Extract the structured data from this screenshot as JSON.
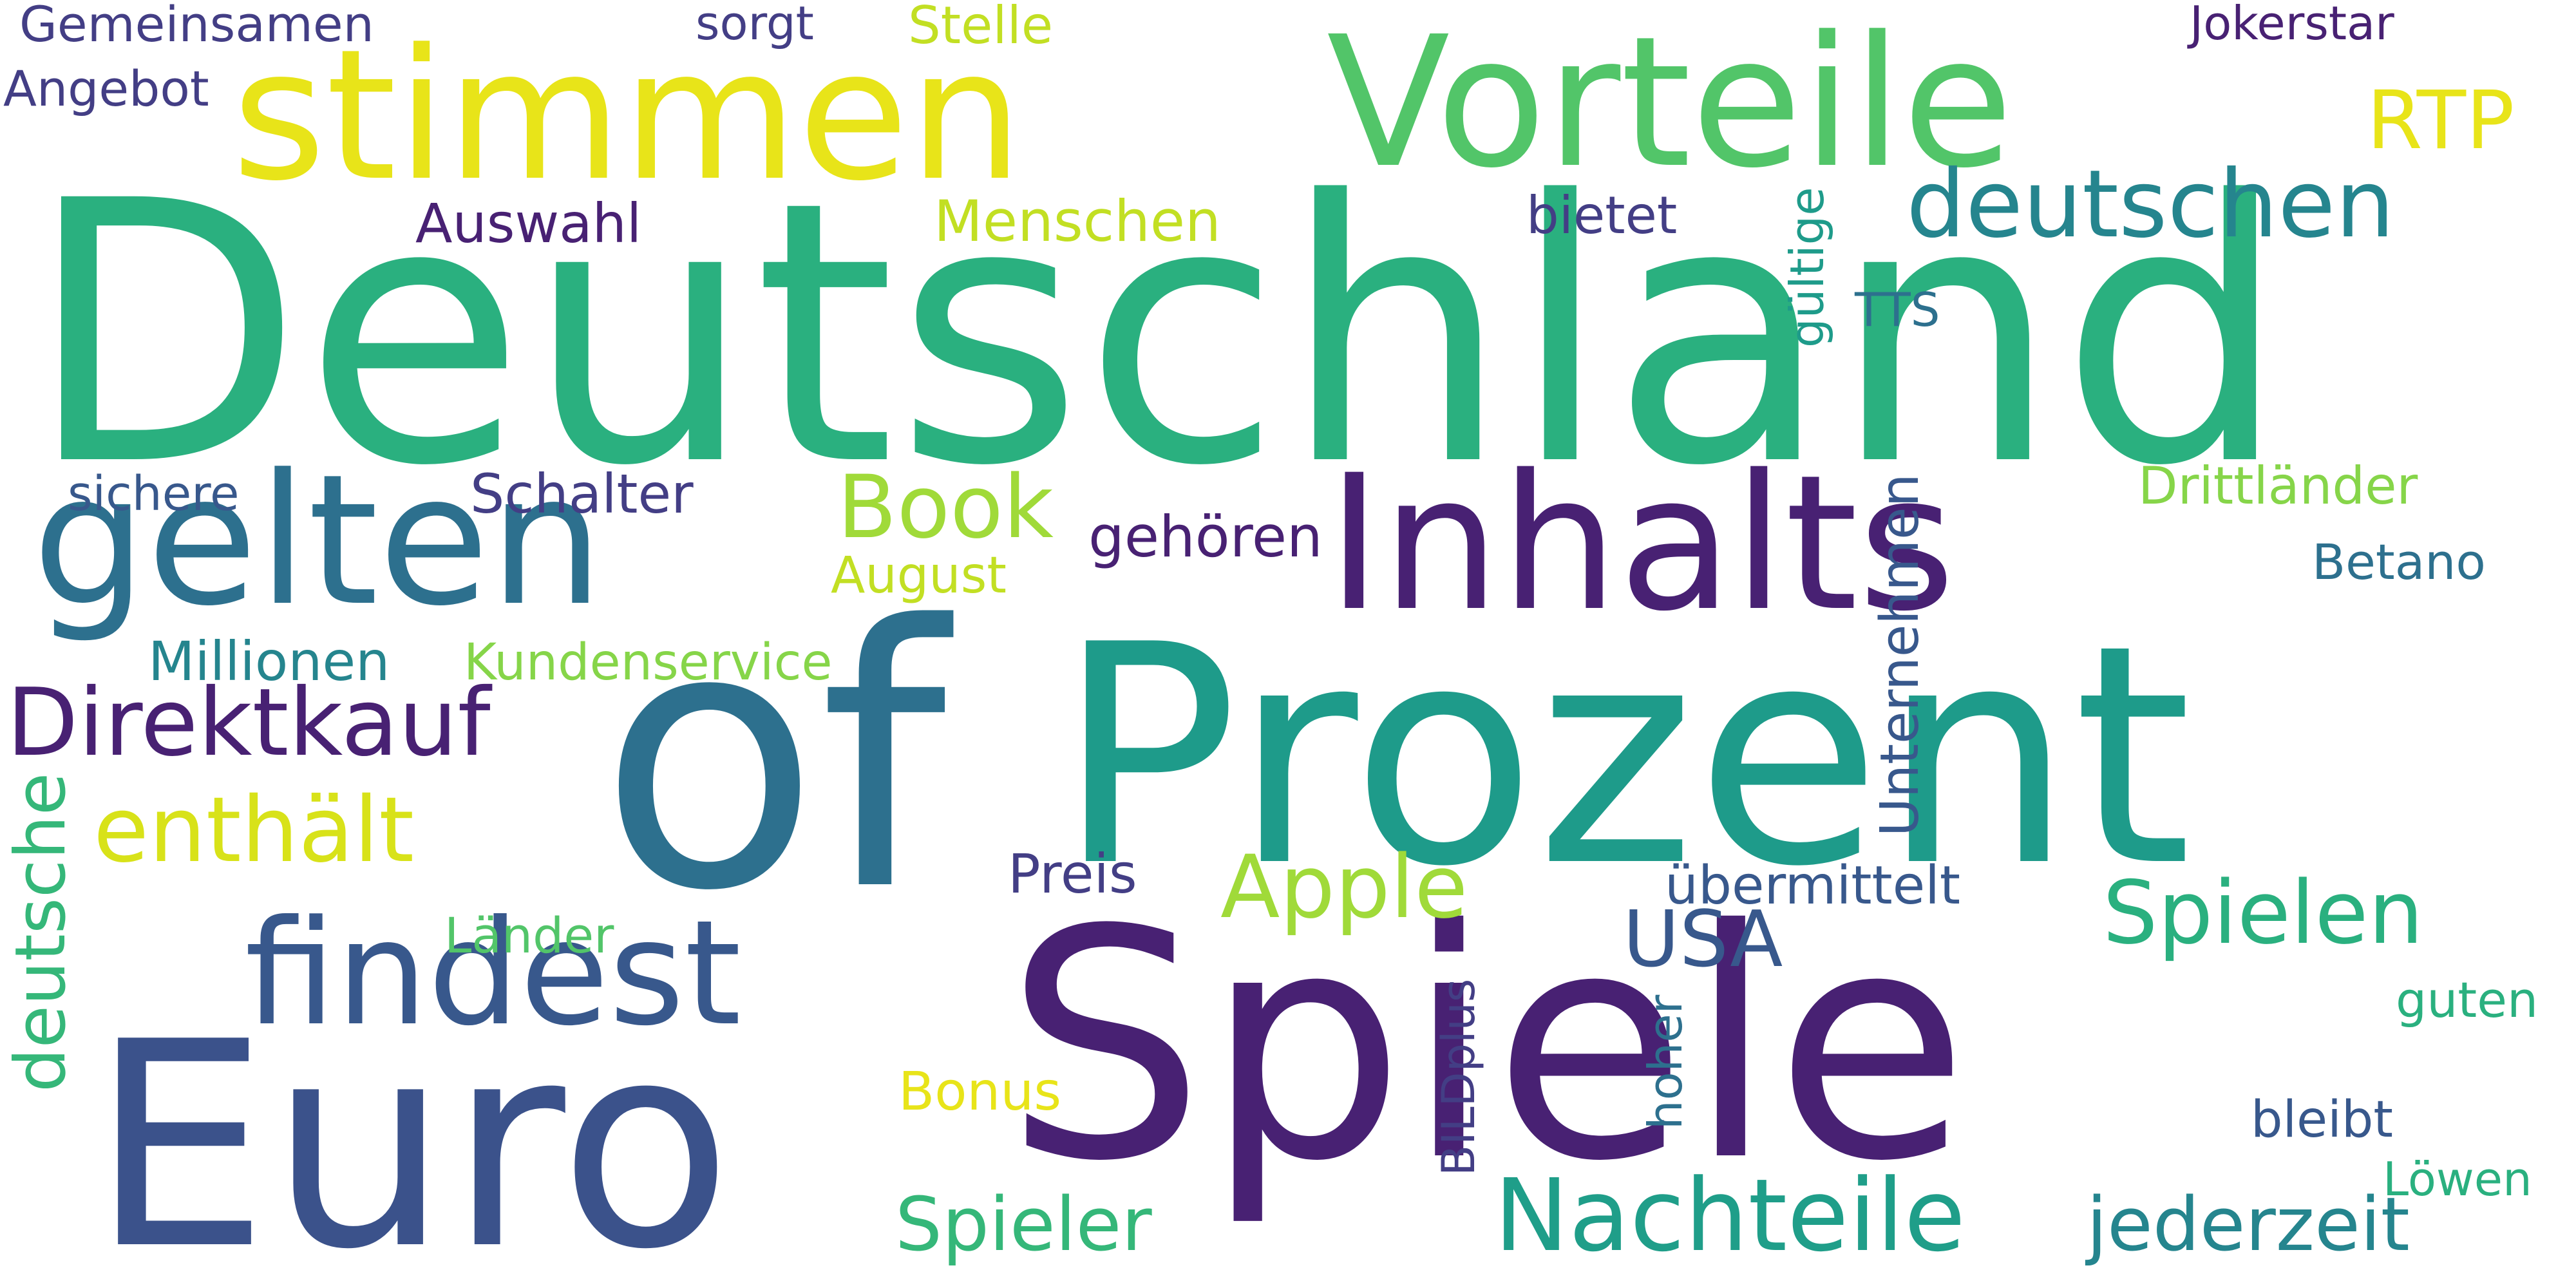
{
  "canvas": {
    "background": "#ffffff"
  },
  "palette": {
    "deep_purple": "#482173",
    "indigo": "#433e85",
    "blue": "#38588c",
    "steel_blue": "#2d708e",
    "teal": "#25858e",
    "green_teal": "#1e9b8a",
    "green": "#2ab07f",
    "light_green": "#52c569",
    "lime": "#86d549",
    "yellow_green": "#c2df23",
    "yellow": "#e8e419"
  },
  "words": [
    {
      "text": "Deutschland",
      "color": "#2ab07f",
      "rotation": 0
    },
    {
      "text": "Prozent",
      "color": "#1e9b8a",
      "rotation": 0
    },
    {
      "text": "Spiele",
      "color": "#482173",
      "rotation": 0
    },
    {
      "text": "of",
      "color": "#2d708e",
      "rotation": 0
    },
    {
      "text": "Euro",
      "color": "#3b528b",
      "rotation": 0
    },
    {
      "text": "stimmen",
      "color": "#e8e419",
      "rotation": 0
    },
    {
      "text": "Vorteile",
      "color": "#52c569",
      "rotation": 0
    },
    {
      "text": "Inhalts",
      "color": "#482173",
      "rotation": 0
    },
    {
      "text": "gelten",
      "color": "#2d708e",
      "rotation": 0
    },
    {
      "text": "findest",
      "color": "#38588c",
      "rotation": 0
    },
    {
      "text": "deutschen",
      "color": "#25858e",
      "rotation": 0
    },
    {
      "text": "Nachteile",
      "color": "#1f9e89",
      "rotation": 0
    },
    {
      "text": "Direktkauf",
      "color": "#482173",
      "rotation": 0
    },
    {
      "text": "enthält",
      "color": "#d8e219",
      "rotation": 0
    },
    {
      "text": "Book",
      "color": "#a0da39",
      "rotation": 0
    },
    {
      "text": "Apple",
      "color": "#a0da39",
      "rotation": 0
    },
    {
      "text": "Spielen",
      "color": "#2ab07f",
      "rotation": 0
    },
    {
      "text": "Spieler",
      "color": "#35b779",
      "rotation": 0
    },
    {
      "text": "jederzeit",
      "color": "#25858e",
      "rotation": 0
    },
    {
      "text": "USA",
      "color": "#38588c",
      "rotation": 0
    },
    {
      "text": "RTP",
      "color": "#e8e419",
      "rotation": 0
    },
    {
      "text": "deutsche",
      "color": "#35b779",
      "rotation": -90
    },
    {
      "text": "gehören",
      "color": "#482173",
      "rotation": 0
    },
    {
      "text": "Menschen",
      "color": "#c2df23",
      "rotation": 0
    },
    {
      "text": "Auswahl",
      "color": "#482173",
      "rotation": 0
    },
    {
      "text": "Schalter",
      "color": "#433e85",
      "rotation": 0
    },
    {
      "text": "Drittländer",
      "color": "#86d549",
      "rotation": 0
    },
    {
      "text": "Betano",
      "color": "#2d708e",
      "rotation": 0
    },
    {
      "text": "Millionen",
      "color": "#25858e",
      "rotation": 0
    },
    {
      "text": "Kundenservice",
      "color": "#86d549",
      "rotation": 0
    },
    {
      "text": "August",
      "color": "#c2df23",
      "rotation": 0
    },
    {
      "text": "sichere",
      "color": "#38588c",
      "rotation": 0
    },
    {
      "text": "Preis",
      "color": "#433e85",
      "rotation": 0
    },
    {
      "text": "übermittelt",
      "color": "#38588c",
      "rotation": 0
    },
    {
      "text": "Unternehmen",
      "color": "#38588c",
      "rotation": -90
    },
    {
      "text": "gültige",
      "color": "#1e9b8a",
      "rotation": -90
    },
    {
      "text": "TTS",
      "color": "#2d708e",
      "rotation": 0
    },
    {
      "text": "bietet",
      "color": "#433e85",
      "rotation": 0
    },
    {
      "text": "Länder",
      "color": "#52c569",
      "rotation": 0
    },
    {
      "text": "Bonus",
      "color": "#e8e419",
      "rotation": 0
    },
    {
      "text": "BILDplus",
      "color": "#433e85",
      "rotation": -90
    },
    {
      "text": "hoher",
      "color": "#2d708e",
      "rotation": -90
    },
    {
      "text": "guten",
      "color": "#2ab07f",
      "rotation": 0
    },
    {
      "text": "bleibt",
      "color": "#38588c",
      "rotation": 0
    },
    {
      "text": "Löwen",
      "color": "#2ab07f",
      "rotation": 0
    },
    {
      "text": "Gemeinsamen",
      "color": "#433e85",
      "rotation": 0
    },
    {
      "text": "Angebot",
      "color": "#433e85",
      "rotation": 0
    },
    {
      "text": "sorgt",
      "color": "#433e85",
      "rotation": 0
    },
    {
      "text": "Stelle",
      "color": "#c2df23",
      "rotation": 0
    },
    {
      "text": "Jokerstar",
      "color": "#482173",
      "rotation": 0
    }
  ]
}
